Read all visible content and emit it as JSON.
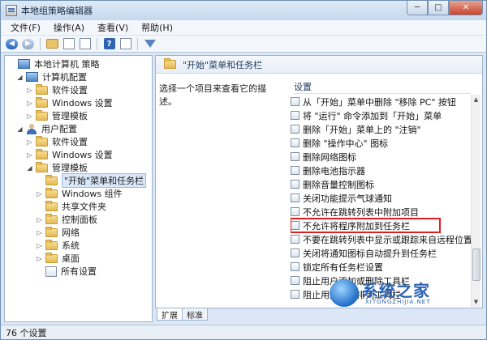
{
  "window": {
    "title": "本地组策略编辑器"
  },
  "menu": [
    "文件(F)",
    "操作(A)",
    "查看(V)",
    "帮助(H)"
  ],
  "tree": [
    {
      "label": "本地计算机 策略",
      "level": 0,
      "icon": "computer-icon",
      "expander": ""
    },
    {
      "label": "计算机配置",
      "level": 1,
      "icon": "computer-icon",
      "expander": "expanded"
    },
    {
      "label": "软件设置",
      "level": 2,
      "icon": "folder-icon",
      "expander": "collapsed"
    },
    {
      "label": "Windows 设置",
      "level": 2,
      "icon": "folder-icon",
      "expander": "collapsed"
    },
    {
      "label": "管理模板",
      "level": 2,
      "icon": "folder-icon",
      "expander": "collapsed"
    },
    {
      "label": "用户配置",
      "level": 1,
      "icon": "user-icon",
      "expander": "expanded"
    },
    {
      "label": "软件设置",
      "level": 2,
      "icon": "folder-icon",
      "expander": "collapsed"
    },
    {
      "label": "Windows 设置",
      "level": 2,
      "icon": "folder-icon",
      "expander": "collapsed"
    },
    {
      "label": "管理模板",
      "level": 2,
      "icon": "folder-icon",
      "expander": "expanded"
    },
    {
      "label": "\"开始\"菜单和任务栏",
      "level": 3,
      "icon": "folder-icon",
      "expander": "",
      "selected": true
    },
    {
      "label": "Windows 组件",
      "level": 3,
      "icon": "folder-icon",
      "expander": "collapsed"
    },
    {
      "label": "共享文件夹",
      "level": 3,
      "icon": "folder-icon",
      "expander": ""
    },
    {
      "label": "控制面板",
      "level": 3,
      "icon": "folder-icon",
      "expander": "collapsed"
    },
    {
      "label": "网络",
      "level": 3,
      "icon": "folder-icon",
      "expander": "collapsed"
    },
    {
      "label": "系统",
      "level": 3,
      "icon": "folder-icon",
      "expander": "collapsed"
    },
    {
      "label": "桌面",
      "level": 3,
      "icon": "folder-icon",
      "expander": "collapsed"
    },
    {
      "label": "所有设置",
      "level": 3,
      "icon": "policy-icon",
      "expander": ""
    }
  ],
  "right": {
    "header_title": "\"开始\"菜单和任务栏",
    "description": "选择一个项目来查看它的描述。",
    "column": "设置",
    "items": [
      {
        "label": "从「开始」菜单中删除 \"移除 PC\" 按钮"
      },
      {
        "label": "将 \"运行\" 命令添加到「开始」菜单"
      },
      {
        "label": "删除「开始」菜单上的 \"注销\""
      },
      {
        "label": "删除 \"操作中心\" 图标"
      },
      {
        "label": "删除网络图标"
      },
      {
        "label": "删除电池指示器"
      },
      {
        "label": "删除音量控制图标"
      },
      {
        "label": "关闭功能提示气球通知"
      },
      {
        "label": "不允许在跳转列表中附加项目"
      },
      {
        "label": "不允许将程序附加到任务栏",
        "highlighted": true
      },
      {
        "label": "不要在跳转列表中显示或跟踪来自远程位置的项目"
      },
      {
        "label": "关闭将通知图标自动提升到任务栏"
      },
      {
        "label": "锁定所有任务栏设置"
      },
      {
        "label": "阻止用户添加或删除工具栏"
      },
      {
        "label": "阻止用户重新排列工具栏"
      }
    ]
  },
  "tabs": [
    "扩展",
    "标准"
  ],
  "status": "76 个设置",
  "watermark": {
    "main": "系统之家",
    "sub": "XITONGZHIJIA.NET"
  }
}
